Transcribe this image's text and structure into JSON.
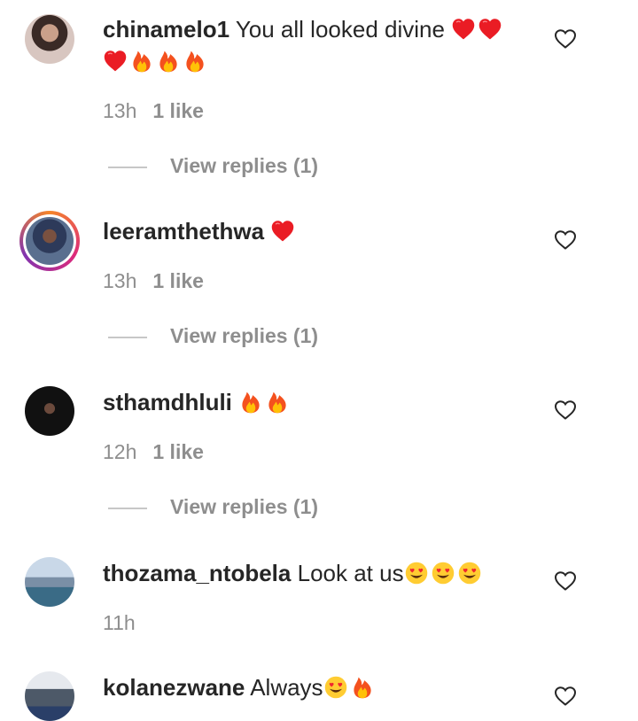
{
  "comments": [
    {
      "username": "chinamelo1",
      "text": "You all looked divine",
      "emojis": [
        "heart",
        "heart",
        "heart",
        "fire",
        "fire",
        "fire"
      ],
      "time": "13h",
      "likes": "1 like",
      "replies": "View replies (1)"
    },
    {
      "username": "leeramthethwa",
      "text": "",
      "emojis": [
        "heart"
      ],
      "time": "13h",
      "likes": "1 like",
      "replies": "View replies (1)"
    },
    {
      "username": "sthamdhluli",
      "text": "",
      "emojis": [
        "fire",
        "fire"
      ],
      "time": "12h",
      "likes": "1 like",
      "replies": "View replies (1)"
    },
    {
      "username": "thozama_ntobela",
      "text": "Look at us",
      "emojis": [
        "heart-eyes",
        "heart-eyes",
        "heart-eyes"
      ],
      "time": "11h",
      "likes": "",
      "replies": ""
    },
    {
      "username": "kolanezwane",
      "text": "Always",
      "emojis": [
        "heart-eyes",
        "fire"
      ],
      "time": "",
      "likes": "",
      "replies": ""
    }
  ],
  "icons": {
    "like": "heart-outline-icon"
  },
  "colors": {
    "text": "#262626",
    "secondary": "#8e8e8e",
    "heart": "#ed1b24",
    "fire": "#f4511e"
  }
}
